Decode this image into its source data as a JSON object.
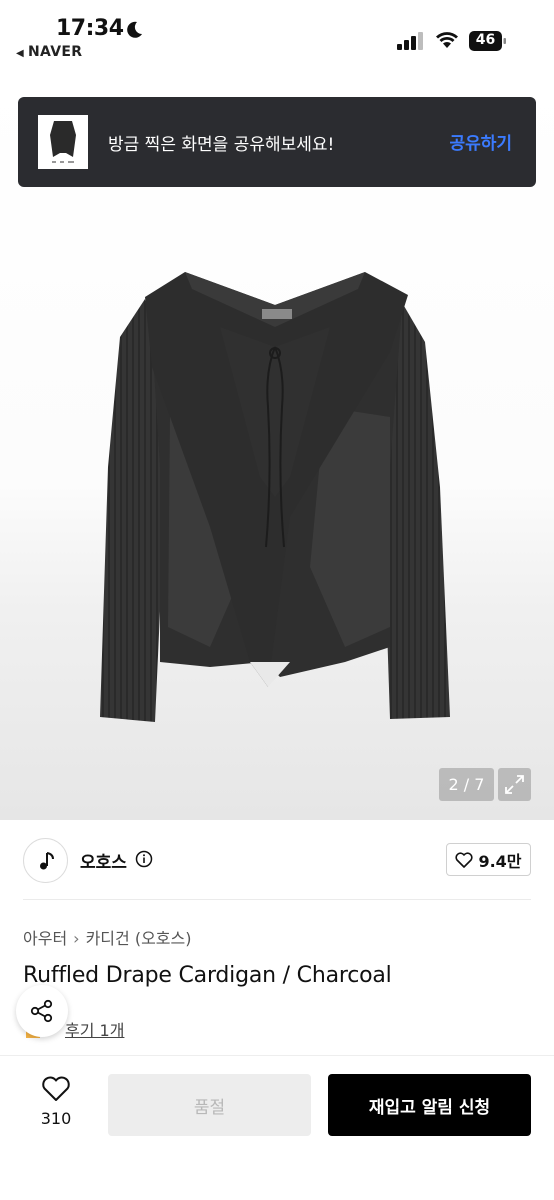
{
  "status_bar": {
    "time": "17:34",
    "back_app": "NAVER",
    "battery": "46"
  },
  "share_banner": {
    "message": "방금 찍은 화면을 공유해보세요!",
    "action": "공유하기"
  },
  "gallery": {
    "pager": "2 / 7"
  },
  "seller": {
    "name": "오호스",
    "likes": "9.4만"
  },
  "breadcrumb": [
    "아우터",
    "카디건 (오호스)"
  ],
  "product": {
    "title": "Ruffled Drape Cardigan / Charcoal",
    "reviews": "후기 1개"
  },
  "bottom_bar": {
    "wish_count": "310",
    "sold_out_label": "품절",
    "restock_label": "재입고 알림 신청"
  },
  "colors": {
    "banner_bg": "#2b2c30",
    "banner_action": "#3b7bff",
    "primary_button": "#000000",
    "disabled_button": "#ededed"
  }
}
